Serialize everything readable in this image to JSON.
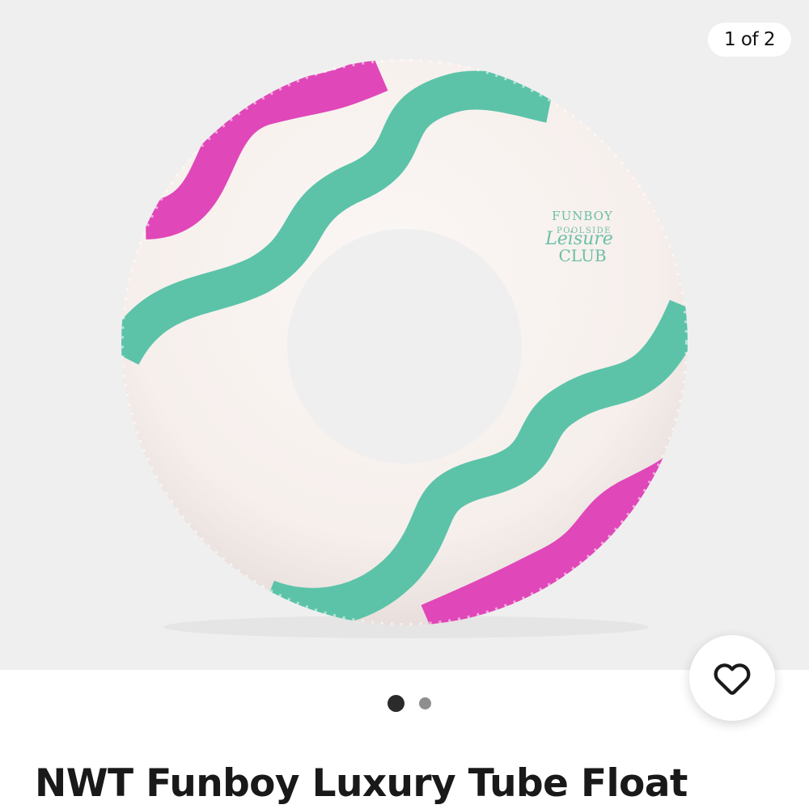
{
  "gallery": {
    "counter": "1 of 2",
    "current_index": 1,
    "total_images": 2,
    "image": {
      "description_icon": "pool-float-product-photo",
      "brand_lines": [
        "FUNBOY",
        "POOLSIDE",
        "Leisure",
        "CLUB"
      ]
    }
  },
  "actions": {
    "watch_icon": "heart-icon"
  },
  "pagination": {
    "dots": [
      {
        "state": "active"
      },
      {
        "state": "inactive"
      }
    ]
  },
  "listing": {
    "title": "NWT Funboy Luxury Tube Float"
  },
  "colors": {
    "background": "#efefef",
    "float_body": "#f6efec",
    "stripe_pink": "#e047b8",
    "stripe_teal": "#5cc3a8",
    "brand_text": "#6bbfa6"
  }
}
